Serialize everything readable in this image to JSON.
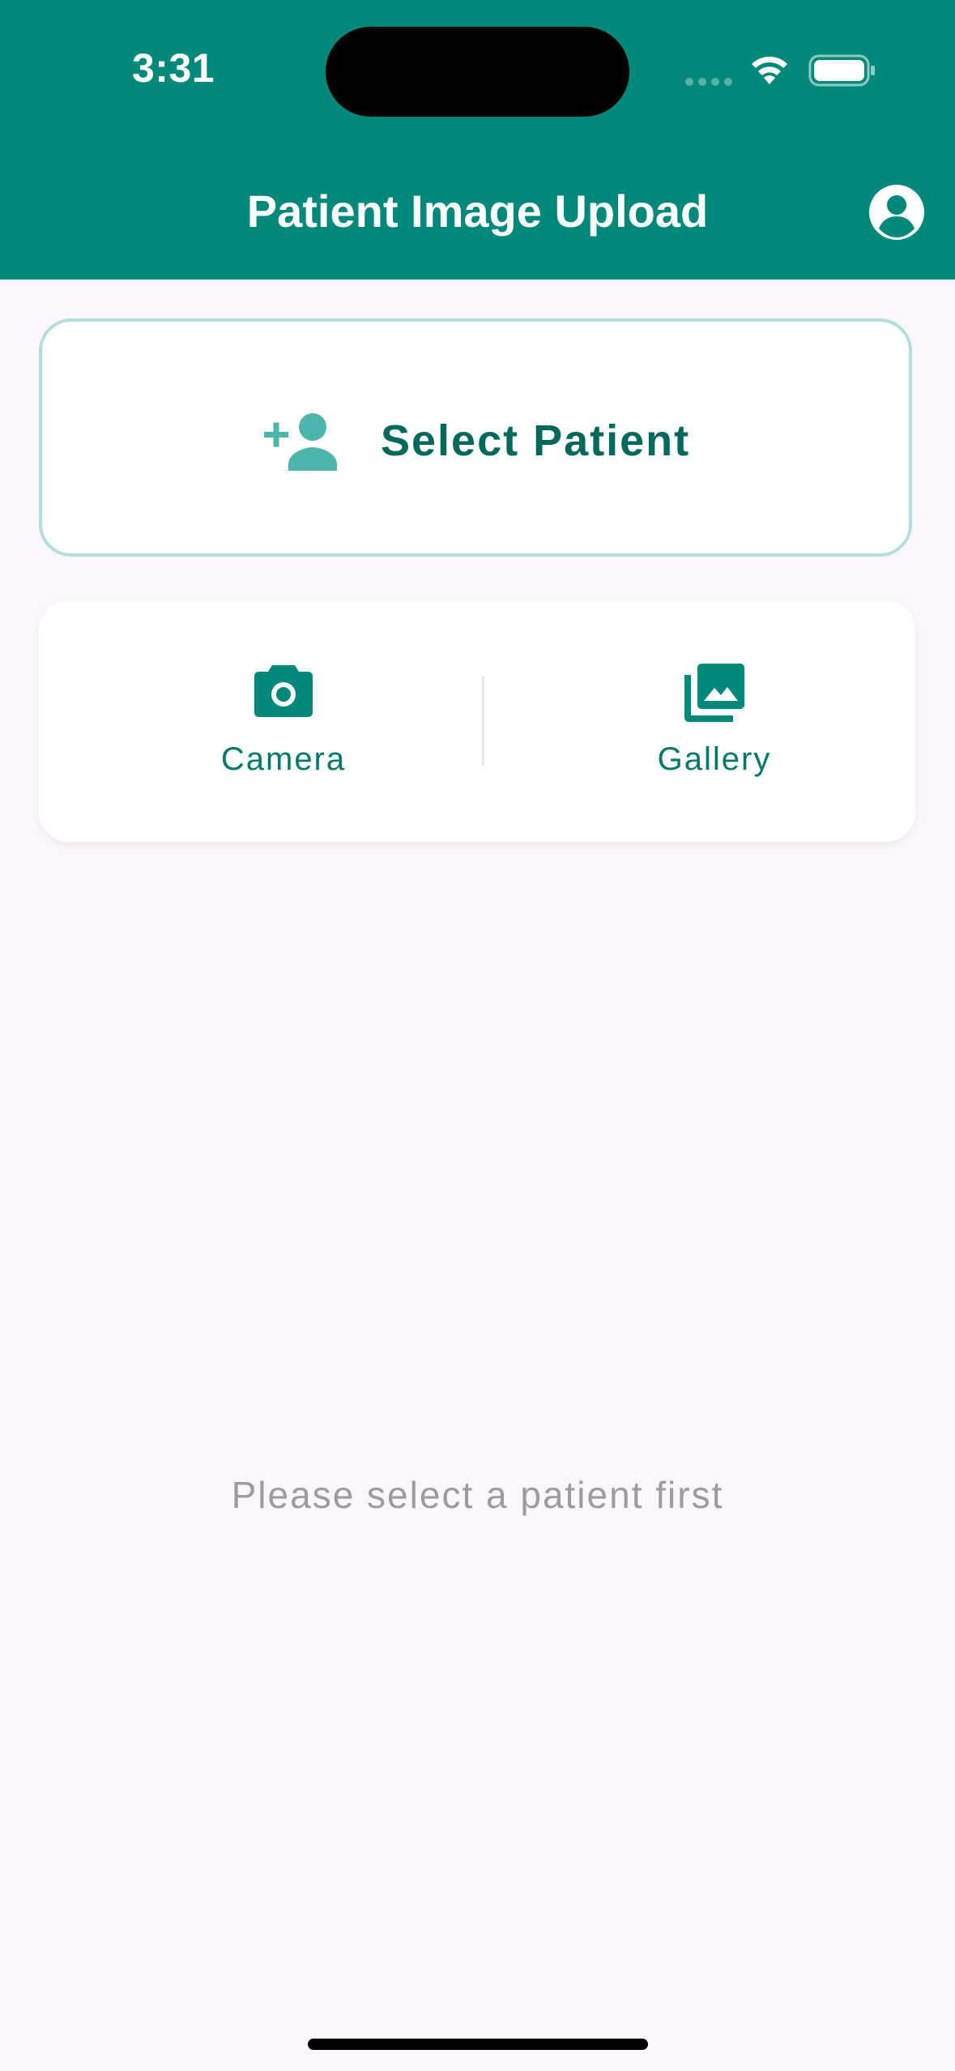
{
  "status_bar": {
    "time": "3:31"
  },
  "app_bar": {
    "title": "Patient Image Upload",
    "background_color": "#00897B",
    "account_icon": "account-circle-icon"
  },
  "select_patient": {
    "label": "Select Patient",
    "icon": "person-add-icon",
    "text_color": "#00695C",
    "border_color": "#B2DFDB"
  },
  "media": {
    "camera": {
      "label": "Camera",
      "icon": "camera-icon"
    },
    "gallery": {
      "label": "Gallery",
      "icon": "photo-library-icon"
    },
    "accent_color": "#00796B"
  },
  "empty_state": {
    "message": "Please select a patient first"
  }
}
